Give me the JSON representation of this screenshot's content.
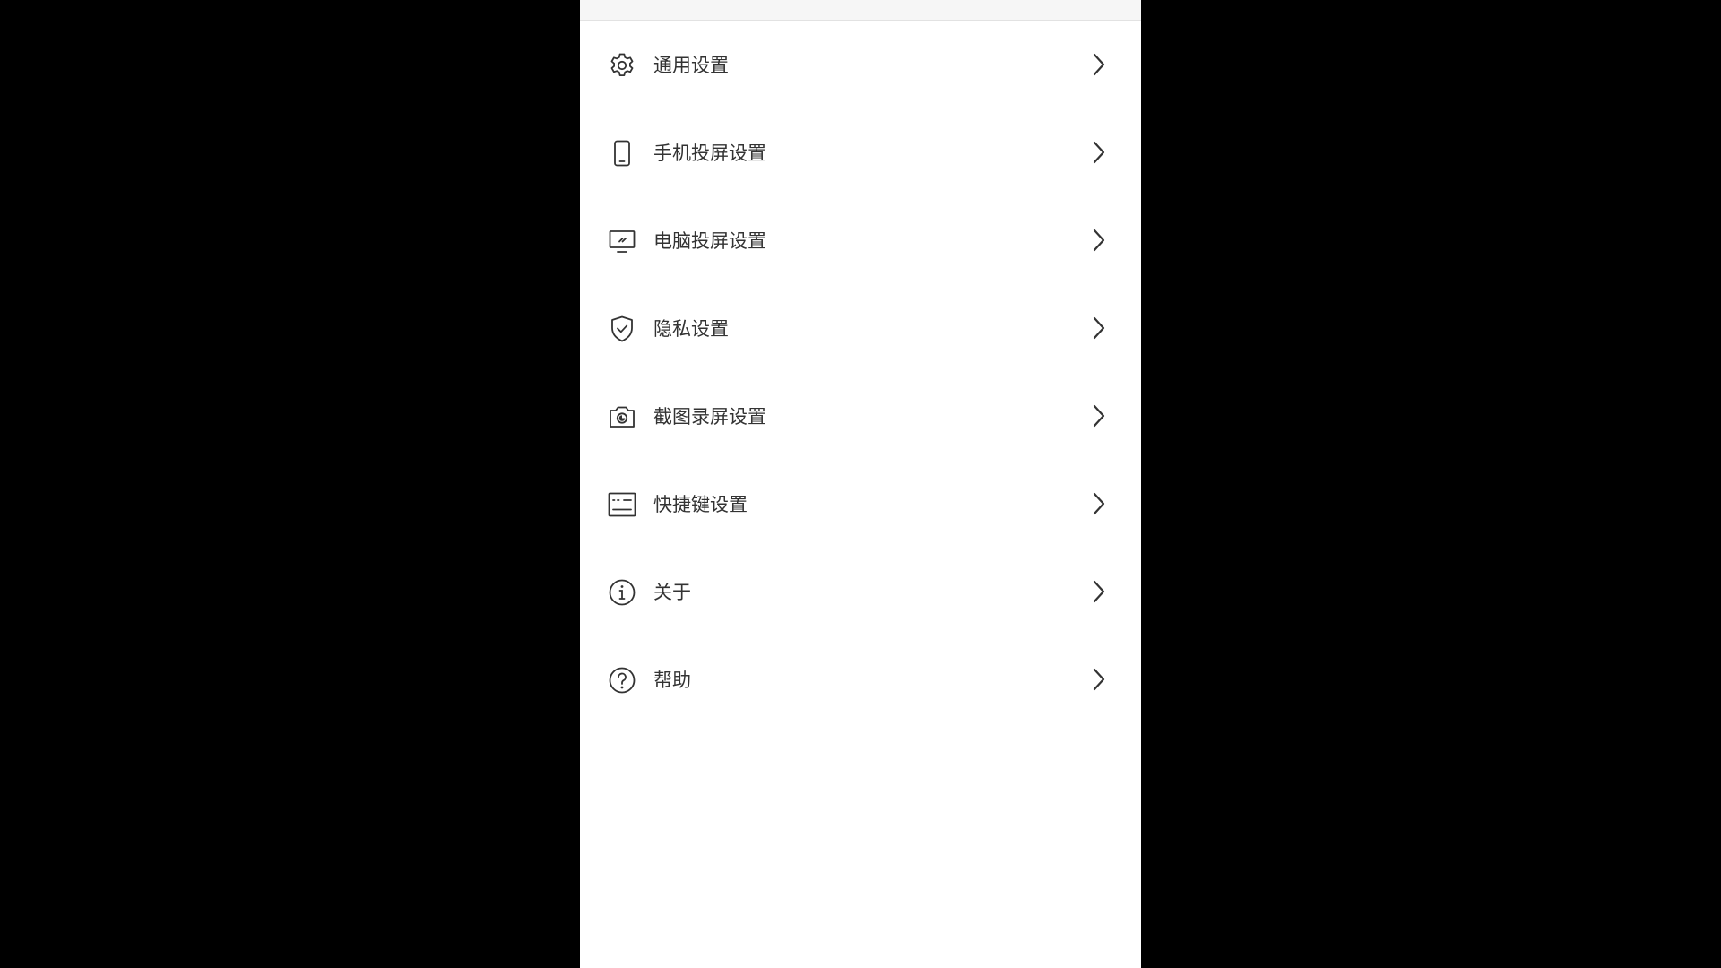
{
  "colors": {
    "background": "#000000",
    "panel": "#ffffff",
    "top_bar": "#f6f6f6",
    "text": "#333333",
    "icon": "#333333"
  },
  "settings_menu": {
    "items": [
      {
        "label": "通用设置",
        "icon": "gear-icon"
      },
      {
        "label": "手机投屏设置",
        "icon": "phone-icon"
      },
      {
        "label": "电脑投屏设置",
        "icon": "monitor-icon"
      },
      {
        "label": "隐私设置",
        "icon": "shield-check-icon"
      },
      {
        "label": "截图录屏设置",
        "icon": "camera-icon"
      },
      {
        "label": "快捷键设置",
        "icon": "keyboard-icon"
      },
      {
        "label": "关于",
        "icon": "info-icon"
      },
      {
        "label": "帮助",
        "icon": "help-icon"
      }
    ],
    "chevron_icon": "chevron-right-icon"
  }
}
